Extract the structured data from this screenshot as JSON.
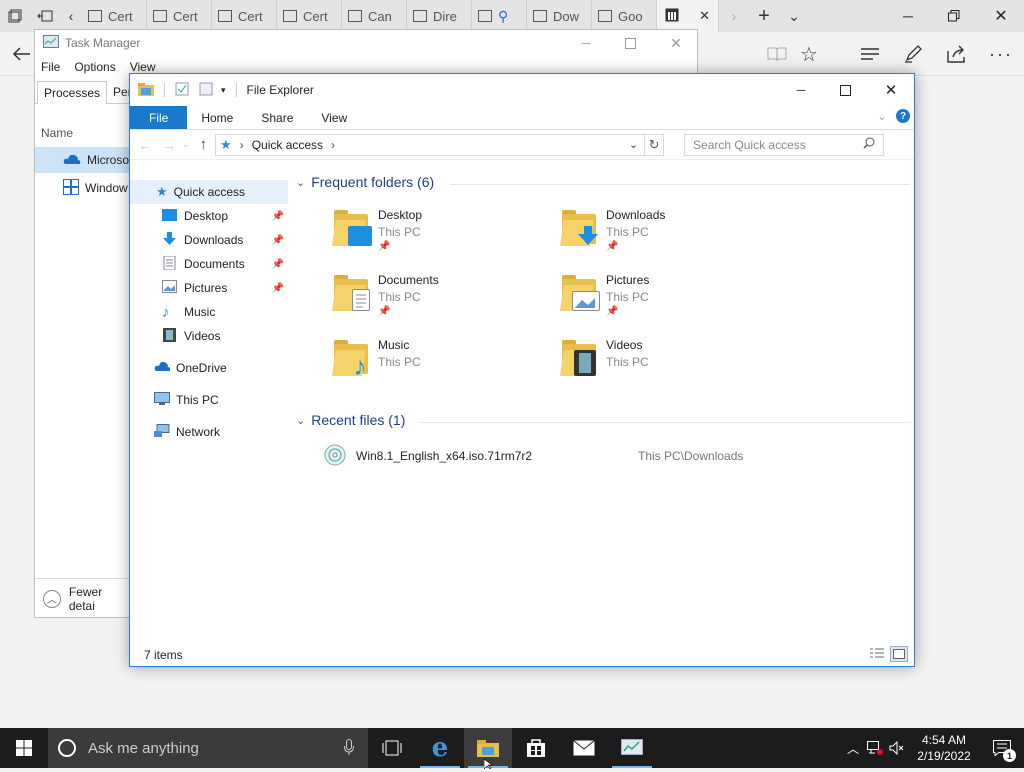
{
  "edge": {
    "tabs": [
      "Cert",
      "Cert",
      "Cert",
      "Cert",
      "Can",
      "Dire",
      "",
      "Dow",
      "Goo"
    ],
    "close_symbol": "✕"
  },
  "task_manager": {
    "title": "Task Manager",
    "menu": [
      "File",
      "Options",
      "View"
    ],
    "tabs": [
      "Processes",
      "Perfo"
    ],
    "column_name": "Name",
    "rows": [
      "Microsof",
      "Window"
    ],
    "fewer_details": "Fewer detai"
  },
  "explorer": {
    "title": "File Explorer",
    "ribbon_tabs": [
      "File",
      "Home",
      "Share",
      "View"
    ],
    "address": "Quick access",
    "search_placeholder": "Search Quick access",
    "nav": {
      "quick_access": "Quick access",
      "items": [
        "Desktop",
        "Downloads",
        "Documents",
        "Pictures",
        "Music",
        "Videos"
      ],
      "onedrive": "OneDrive",
      "this_pc": "This PC",
      "network": "Network"
    },
    "frequent_header": "Frequent folders (6)",
    "folders": [
      {
        "name": "Desktop",
        "location": "This PC"
      },
      {
        "name": "Downloads",
        "location": "This PC"
      },
      {
        "name": "Documents",
        "location": "This PC"
      },
      {
        "name": "Pictures",
        "location": "This PC"
      },
      {
        "name": "Music",
        "location": "This PC"
      },
      {
        "name": "Videos",
        "location": "This PC"
      }
    ],
    "recent_header": "Recent files (1)",
    "recent_files": [
      {
        "name": "Win8.1_English_x64.iso.71rm7r2",
        "path": "This PC\\Downloads"
      }
    ],
    "status": "7 items"
  },
  "taskbar": {
    "search_placeholder": "Ask me anything",
    "time": "4:54 AM",
    "date": "2/19/2022",
    "notification_count": "1"
  },
  "colors": {
    "accent": "#1979ca",
    "taskbar": "#1c1c1c",
    "folder": "#f6d36a"
  }
}
